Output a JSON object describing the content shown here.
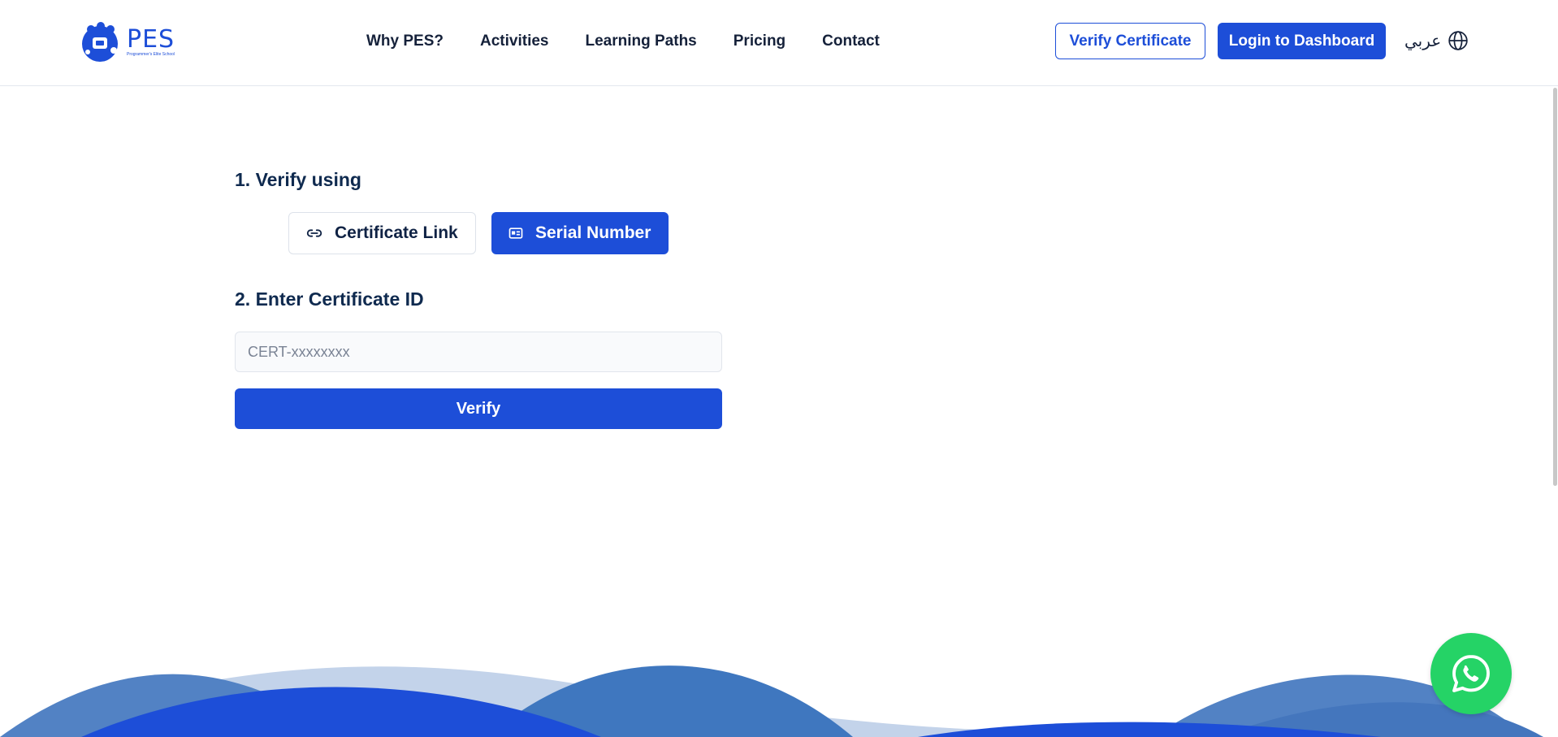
{
  "header": {
    "logo_text": "PES",
    "logo_subtext": "Programmer's Elite School",
    "nav": [
      {
        "label": "Why PES?"
      },
      {
        "label": "Activities"
      },
      {
        "label": "Learning Paths"
      },
      {
        "label": "Pricing"
      },
      {
        "label": "Contact"
      }
    ],
    "verify_certificate_label": "Verify Certificate",
    "login_label": "Login to Dashboard",
    "language_label": "عربي"
  },
  "main": {
    "step1_title": "1. Verify using",
    "options": [
      {
        "label": "Certificate Link",
        "selected": false
      },
      {
        "label": "Serial Number",
        "selected": true
      }
    ],
    "step2_title": "2. Enter Certificate ID",
    "certificate_input": {
      "value": "",
      "placeholder": "CERT-xxxxxxxx"
    },
    "verify_button_label": "Verify"
  },
  "colors": {
    "primary": "#1d4ed8",
    "whatsapp": "#25d366",
    "heading": "#0f2a4f"
  },
  "icons": {
    "link_option": "link-icon",
    "serial_option": "id-card-icon",
    "language": "globe-icon",
    "floating": "whatsapp-icon"
  }
}
